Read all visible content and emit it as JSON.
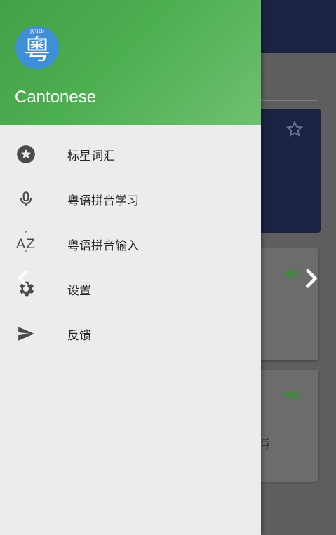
{
  "app": {
    "name": "Cantonese",
    "logo_char": "粵",
    "logo_sub": "jyut6"
  },
  "colors": {
    "header_start": "#43a047",
    "header_end": "#6fc070",
    "logo_bg": "#3f8fd8",
    "drawer_bg": "#ececec",
    "topbar_bg": "#1a2344",
    "speaker": "#3c8a3c"
  },
  "menu": {
    "items": [
      {
        "label": "标星词汇",
        "icon": "star-circle-icon"
      },
      {
        "label": "粤语拼音学习",
        "icon": "microphone-icon"
      },
      {
        "label": "粤语拼音输入",
        "icon": "sort-az-icon",
        "icon_text": "AZ"
      },
      {
        "label": "设置",
        "icon": "settings-gear-icon"
      },
      {
        "label": "反馈",
        "icon": "send-icon"
      }
    ]
  },
  "background": {
    "card_partial_char": "字"
  }
}
